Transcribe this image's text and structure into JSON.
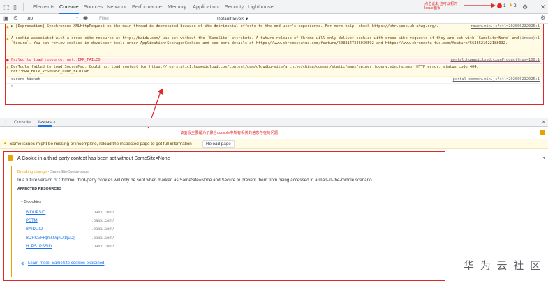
{
  "tabs": [
    {
      "label": "Elements",
      "active": false
    },
    {
      "label": "Console",
      "active": true
    },
    {
      "label": "Sources",
      "active": false
    },
    {
      "label": "Network",
      "active": false
    },
    {
      "label": "Performance",
      "active": false
    },
    {
      "label": "Memory",
      "active": false
    },
    {
      "label": "Application",
      "active": false
    },
    {
      "label": "Security",
      "active": false
    },
    {
      "label": "Lighthouse",
      "active": false
    }
  ],
  "top_note": "点击此处也可以打开Issue面板",
  "badges": {
    "errors": "1",
    "warnings": "2"
  },
  "filter": {
    "context": "top",
    "placeholder": "Filter",
    "levels": "Default levels ▾"
  },
  "messages": [
    {
      "type": "warn",
      "text": "▶ [Deprecation] Synchronous XMLHttpRequest on the main thread is deprecated because of its detrimental effects to the end user's experience. For more help, check https://xhr.spec.wh atwg.org/.",
      "src": "raven.min.js?stl=202006232025:1"
    },
    {
      "type": "warn",
      "text": "A cookie associated with a cross-site resource at http://baidu.com/ was set without the `SameSite` attribute. A future release of Chrome will only deliver cookies with cross-site requests if they are set with `SameSite=None` and `Secure`. You can review cookies in developer tools under Application>Storage>Cookies and see more details at https://www.chromestatus.com/feature/5088147346030592 and https://www.chromesta tus.com/feature/5633521622188032.",
      "src": "(index):1"
    },
    {
      "type": "err",
      "text": "Failed to load resource: net::ERR_FAILED",
      "src": "portal.huaweicloud.c…geProduct?num=100:1"
    },
    {
      "type": "warn",
      "text": "DevTools failed to load SourceMap: Could not load content for https://res-static1.huaweicloud.com/content/dam/cloudbu-site/archive/china/common/static/maps/swiper.jquery.min.js.map: HTTP error: status code 404, net::ERR_HTTP_RESPONSE_CODE_FAILURE",
      "src": ""
    },
    {
      "type": "log",
      "text": "succno ticket",
      "src": "portal-common.min.js?stl=202006232025:1"
    }
  ],
  "prompt": ">",
  "drawer": {
    "tabs": [
      "Console",
      "Issues"
    ],
    "close": "×",
    "note": "该面板主要是为了聚合console中所有相关的信息存在的问题"
  },
  "info_bar": {
    "text": "Some issues might be missing or incomplete, reload the inspected page to get full information",
    "button": "Reload page"
  },
  "issue": {
    "title": "A Cookie in a third-party context has been set without SameSite=None",
    "breaking_label": "Breaking change",
    "breaking_sep": " - ",
    "breaking_src": "SameSiteCookieIssue",
    "description": "In a future version of Chrome, third-party cookies will only be sent when marked as SameSite=None and Secure to prevent them from being accessed in a man-in-the-middle scenario.",
    "affected": "AFFECTED RESOURCES",
    "cookies_toggle": "▾ 5 cookies",
    "cookies": [
      {
        "name": "BIDUPSID",
        "domain": ".baidu.com/"
      },
      {
        "name": "PSTM",
        "domain": ".baidu.com/"
      },
      {
        "name": "BAIDUID",
        "domain": ".baidu.com/"
      },
      {
        "name": "BDRCVFR[mkUqnUt8juD]",
        "domain": ".baidu.com/"
      },
      {
        "name": "H_PS_PSSID",
        "domain": ".baidu.com/"
      }
    ],
    "learn_more": "Learn more: SameSite cookies explained"
  },
  "watermark": "华 为 云 社 区",
  "colors": {
    "annotation": "#e02828",
    "link": "#1a73e8",
    "warning_bg": "#fffbe5",
    "error_bg": "#fff0f0"
  }
}
